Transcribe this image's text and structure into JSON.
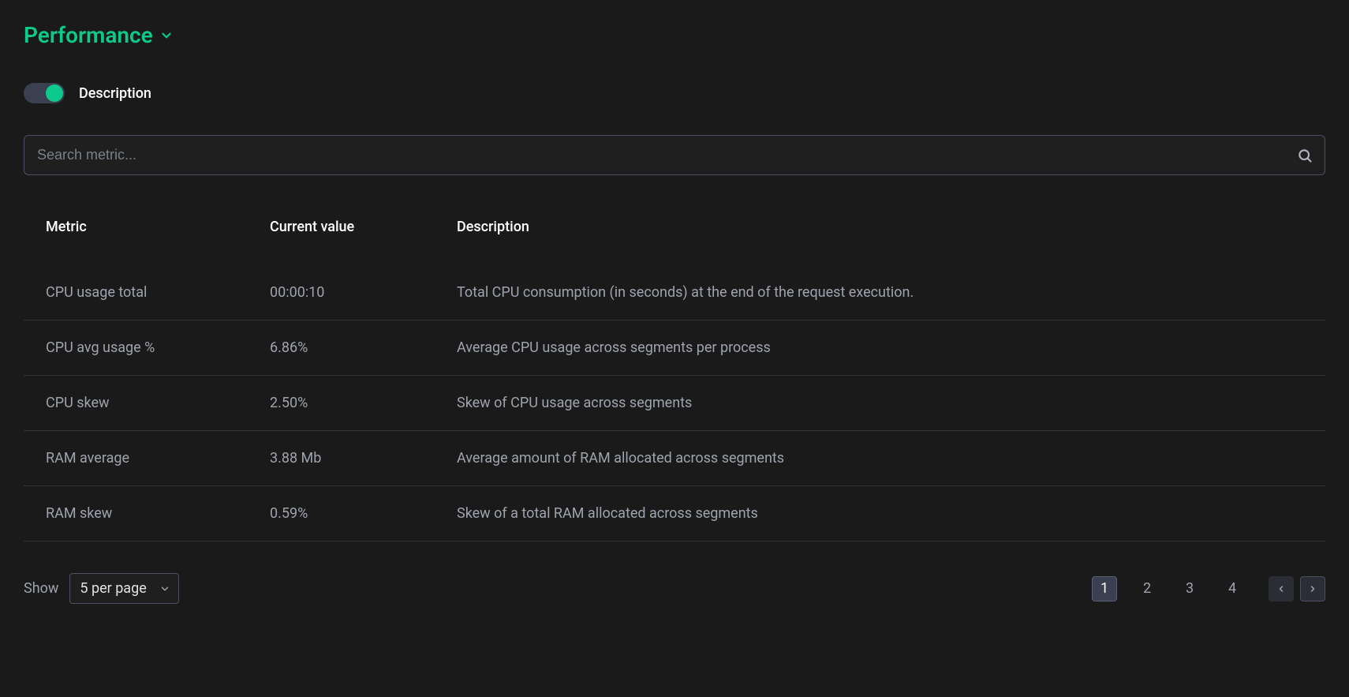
{
  "title": "Performance",
  "toggle": {
    "label": "Description",
    "on": true
  },
  "search": {
    "placeholder": "Search metric..."
  },
  "table": {
    "headers": {
      "metric": "Metric",
      "value": "Current value",
      "description": "Description"
    },
    "rows": [
      {
        "metric": "CPU usage total",
        "value": "00:00:10",
        "description": "Total CPU consumption (in seconds) at the end of the request execution."
      },
      {
        "metric": "CPU avg usage %",
        "value": "6.86%",
        "description": "Average CPU usage across segments per process"
      },
      {
        "metric": "CPU skew",
        "value": "2.50%",
        "description": "Skew of CPU usage across segments"
      },
      {
        "metric": "RAM average",
        "value": "3.88 Mb",
        "description": "Average amount of RAM allocated across segments"
      },
      {
        "metric": "RAM skew",
        "value": "0.59%",
        "description": "Skew of a total RAM  allocated across segments"
      }
    ]
  },
  "footer": {
    "show_label": "Show",
    "page_select": "5 per page",
    "pages": [
      "1",
      "2",
      "3",
      "4"
    ],
    "active_page": "1"
  }
}
